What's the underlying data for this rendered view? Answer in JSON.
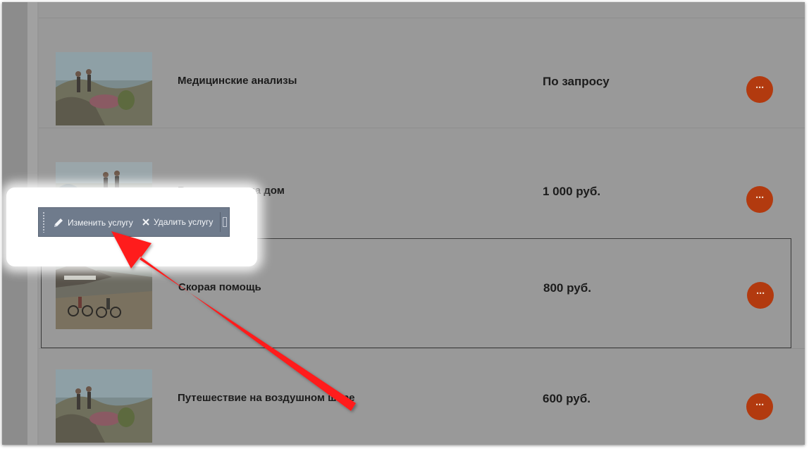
{
  "services": [
    {
      "name": "Медицинские анализы",
      "price": "По запросу",
      "more_label": "···",
      "thumb_icon": "runners-landscape-image"
    },
    {
      "name": "Выезд врача на дом",
      "price": "1 000 руб.",
      "more_label": "···",
      "thumb_icon": "runners-wave-image"
    },
    {
      "name": "Скорая помощь",
      "price": "800 руб.",
      "more_label": "···",
      "thumb_icon": "cyclists-image"
    },
    {
      "name": "Путешествие на воздушном шаре",
      "price": "600 руб.",
      "more_label": "···",
      "thumb_icon": "runners-landscape-image"
    }
  ],
  "toolbar": {
    "edit_label": "Изменить услугу",
    "delete_label": "Удалить услугу"
  },
  "colors": {
    "overlay_gray": "#969696",
    "more_button": "#b23a0f",
    "toolbar_bg": "#6f7b8c",
    "arrow": "#ff1a1a"
  }
}
